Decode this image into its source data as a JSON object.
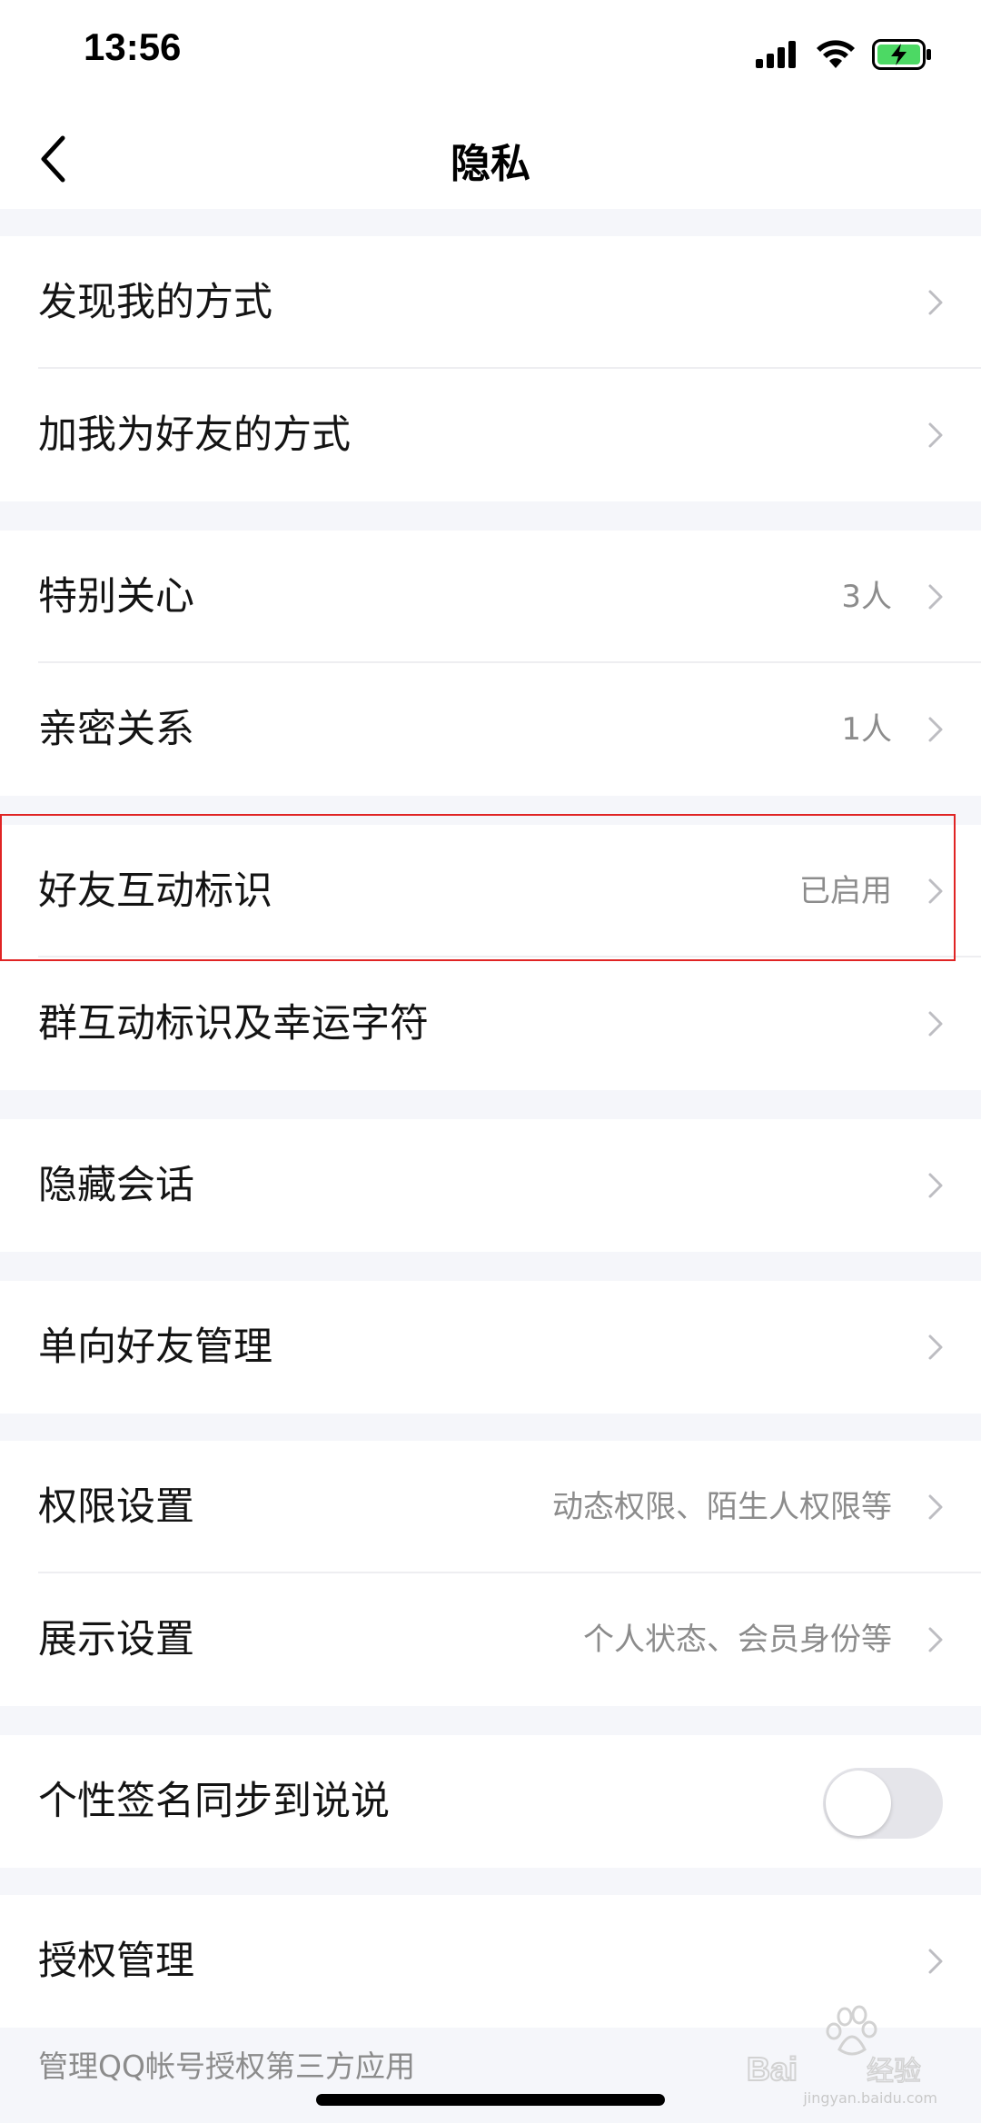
{
  "status_bar": {
    "time": "13:56",
    "icons": [
      "signal-icon",
      "wifi-icon",
      "battery-charging-icon"
    ],
    "battery_color": "#4CD964"
  },
  "nav": {
    "title": "隐私",
    "back_icon": "chevron-left-icon"
  },
  "groups": [
    {
      "rows": [
        {
          "label": "发现我的方式",
          "value": ""
        },
        {
          "label": "加我为好友的方式",
          "value": ""
        }
      ]
    },
    {
      "rows": [
        {
          "label": "特别关心",
          "value": "3人"
        },
        {
          "label": "亲密关系",
          "value": "1人"
        }
      ]
    },
    {
      "rows": [
        {
          "label": "好友互动标识",
          "value": "已启用"
        },
        {
          "label": "群互动标识及幸运字符",
          "value": ""
        }
      ]
    },
    {
      "rows": [
        {
          "label": "隐藏会话",
          "value": ""
        }
      ]
    },
    {
      "rows": [
        {
          "label": "单向好友管理",
          "value": ""
        }
      ]
    },
    {
      "rows": [
        {
          "label": "权限设置",
          "value": "动态权限、陌生人权限等"
        },
        {
          "label": "展示设置",
          "value": "个人状态、会员身份等"
        }
      ]
    },
    {
      "rows": [
        {
          "label": "个性签名同步到说说",
          "toggle": false
        }
      ]
    },
    {
      "rows": [
        {
          "label": "授权管理",
          "value": ""
        }
      ]
    }
  ],
  "footnote": "管理QQ帐号授权第三方应用",
  "watermark": {
    "brand": "Baidu经验",
    "url": "jingyan.baidu.com"
  },
  "colors": {
    "background": "#F5F6FA",
    "highlight_border": "#E02424",
    "secondary_text": "#8C8C8C"
  }
}
